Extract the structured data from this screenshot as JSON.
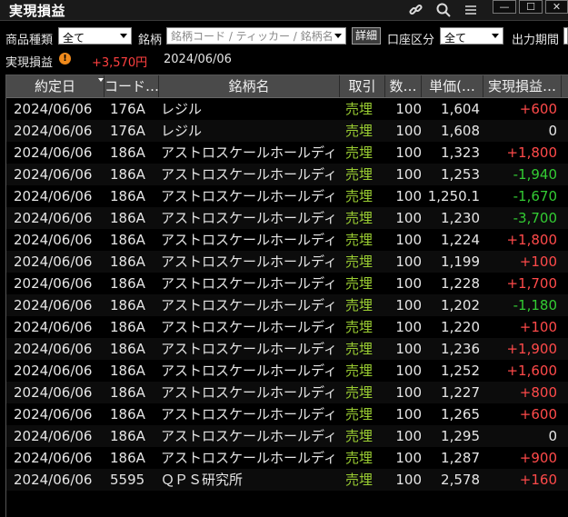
{
  "window": {
    "title": "実現損益",
    "icons": [
      "link-icon",
      "search-icon",
      "menu-icon"
    ],
    "buttons": [
      "—",
      "☐",
      "✕"
    ]
  },
  "filters": {
    "product_type_label": "商品種類",
    "product_type_value": "全て",
    "symbol_label": "銘柄",
    "symbol_placeholder": "銘柄コード / ティッカー / 銘柄名",
    "detail_button": "詳細",
    "account_label": "口座区分",
    "account_value": "全て",
    "period_label": "出力期間"
  },
  "summary": {
    "label": "実現損益",
    "value": "+3,570円",
    "date": "2024/06/06"
  },
  "table": {
    "headers": [
      "約定日",
      "コード…",
      "銘柄名",
      "取引",
      "数…",
      "単価(…",
      "実現損益…"
    ],
    "rows": [
      {
        "date": "2024/06/06",
        "code": "176A",
        "name": "レジル",
        "trade": "売埋",
        "qty": "100",
        "price": "1,604",
        "pnl": "+600",
        "sign": "pos"
      },
      {
        "date": "2024/06/06",
        "code": "176A",
        "name": "レジル",
        "trade": "売埋",
        "qty": "100",
        "price": "1,608",
        "pnl": "0",
        "sign": "zero"
      },
      {
        "date": "2024/06/06",
        "code": "186A",
        "name": "アストロスケールホールディンク",
        "trade": "売埋",
        "qty": "100",
        "price": "1,323",
        "pnl": "+1,800",
        "sign": "pos"
      },
      {
        "date": "2024/06/06",
        "code": "186A",
        "name": "アストロスケールホールディンク",
        "trade": "売埋",
        "qty": "100",
        "price": "1,253",
        "pnl": "-1,940",
        "sign": "neg"
      },
      {
        "date": "2024/06/06",
        "code": "186A",
        "name": "アストロスケールホールディンク",
        "trade": "売埋",
        "qty": "100",
        "price": "1,250.1",
        "pnl": "-1,670",
        "sign": "neg"
      },
      {
        "date": "2024/06/06",
        "code": "186A",
        "name": "アストロスケールホールディンク",
        "trade": "売埋",
        "qty": "100",
        "price": "1,230",
        "pnl": "-3,700",
        "sign": "neg"
      },
      {
        "date": "2024/06/06",
        "code": "186A",
        "name": "アストロスケールホールディンク",
        "trade": "売埋",
        "qty": "100",
        "price": "1,224",
        "pnl": "+1,800",
        "sign": "pos"
      },
      {
        "date": "2024/06/06",
        "code": "186A",
        "name": "アストロスケールホールディンク",
        "trade": "売埋",
        "qty": "100",
        "price": "1,199",
        "pnl": "+100",
        "sign": "pos"
      },
      {
        "date": "2024/06/06",
        "code": "186A",
        "name": "アストロスケールホールディンク",
        "trade": "売埋",
        "qty": "100",
        "price": "1,228",
        "pnl": "+1,700",
        "sign": "pos"
      },
      {
        "date": "2024/06/06",
        "code": "186A",
        "name": "アストロスケールホールディンク",
        "trade": "売埋",
        "qty": "100",
        "price": "1,202",
        "pnl": "-1,180",
        "sign": "neg"
      },
      {
        "date": "2024/06/06",
        "code": "186A",
        "name": "アストロスケールホールディンク",
        "trade": "売埋",
        "qty": "100",
        "price": "1,220",
        "pnl": "+100",
        "sign": "pos"
      },
      {
        "date": "2024/06/06",
        "code": "186A",
        "name": "アストロスケールホールディンク",
        "trade": "売埋",
        "qty": "100",
        "price": "1,236",
        "pnl": "+1,900",
        "sign": "pos"
      },
      {
        "date": "2024/06/06",
        "code": "186A",
        "name": "アストロスケールホールディンク",
        "trade": "売埋",
        "qty": "100",
        "price": "1,252",
        "pnl": "+1,600",
        "sign": "pos"
      },
      {
        "date": "2024/06/06",
        "code": "186A",
        "name": "アストロスケールホールディンク",
        "trade": "売埋",
        "qty": "100",
        "price": "1,227",
        "pnl": "+800",
        "sign": "pos"
      },
      {
        "date": "2024/06/06",
        "code": "186A",
        "name": "アストロスケールホールディンク",
        "trade": "売埋",
        "qty": "100",
        "price": "1,265",
        "pnl": "+600",
        "sign": "pos"
      },
      {
        "date": "2024/06/06",
        "code": "186A",
        "name": "アストロスケールホールディンク",
        "trade": "売埋",
        "qty": "100",
        "price": "1,295",
        "pnl": "0",
        "sign": "zero"
      },
      {
        "date": "2024/06/06",
        "code": "186A",
        "name": "アストロスケールホールディンク",
        "trade": "売埋",
        "qty": "100",
        "price": "1,287",
        "pnl": "+900",
        "sign": "pos"
      },
      {
        "date": "2024/06/06",
        "code": "5595",
        "name": "ＱＰＳ研究所",
        "trade": "売埋",
        "qty": "100",
        "price": "2,578",
        "pnl": "+160",
        "sign": "pos"
      }
    ]
  },
  "colors": {
    "positive": "#ff4a4a",
    "negative": "#33cc33",
    "trade": "#9acd32",
    "warning": "#f08a1c"
  }
}
